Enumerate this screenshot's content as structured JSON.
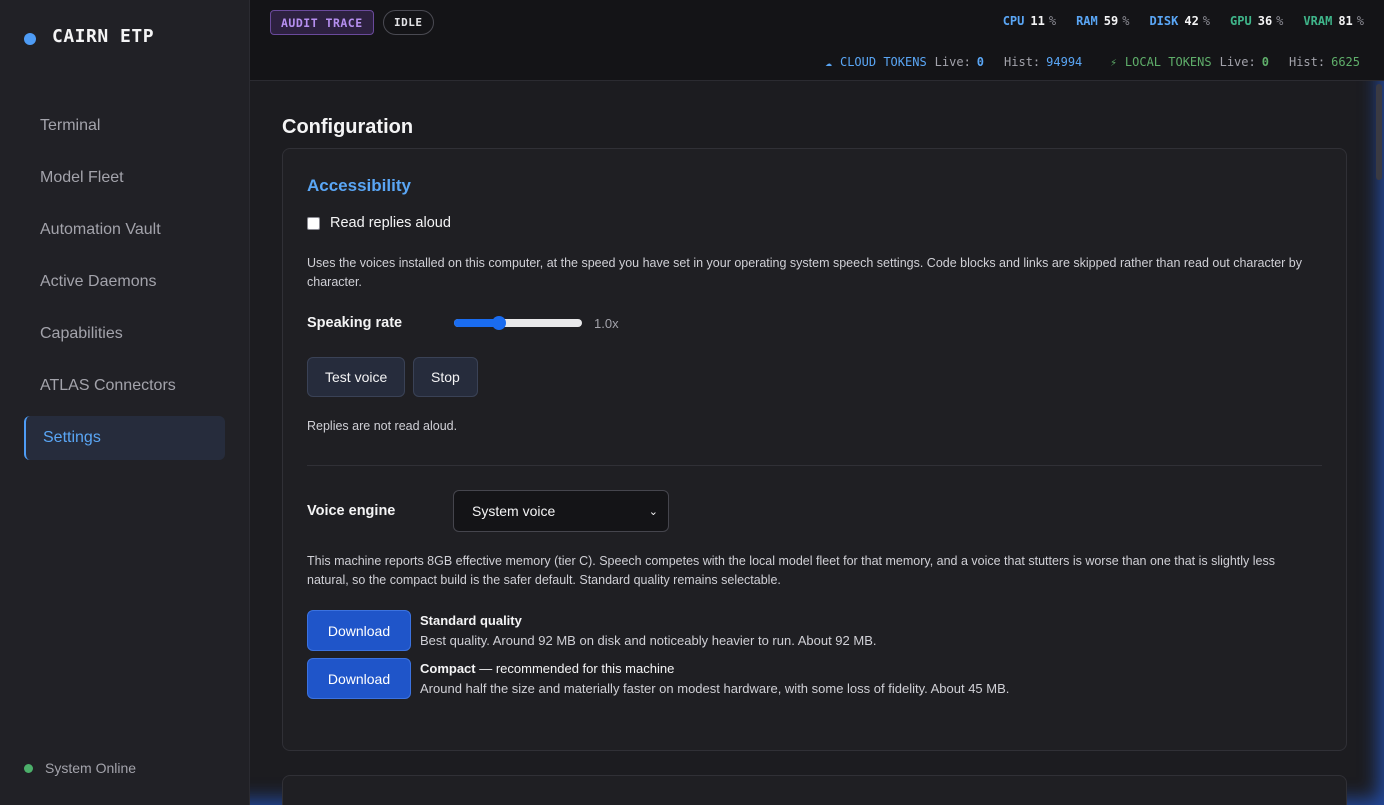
{
  "app": {
    "title": "CAIRN ETP"
  },
  "sidebar": {
    "items": [
      {
        "label": "Terminal",
        "active": false
      },
      {
        "label": "Model Fleet",
        "active": false
      },
      {
        "label": "Automation Vault",
        "active": false
      },
      {
        "label": "Active Daemons",
        "active": false
      },
      {
        "label": "Capabilities",
        "active": false
      },
      {
        "label": "ATLAS Connectors",
        "active": false
      },
      {
        "label": "Settings",
        "active": true
      }
    ],
    "status": "System Online"
  },
  "header": {
    "audit_chip": "AUDIT TRACE",
    "idle_chip": "IDLE",
    "metrics": [
      {
        "key": "CPU",
        "value": "11",
        "unit": "%",
        "color": "#5aa6f5"
      },
      {
        "key": "RAM",
        "value": "59",
        "unit": "%",
        "color": "#5aa6f5"
      },
      {
        "key": "DISK",
        "value": "42",
        "unit": "%",
        "color": "#5aa6f5"
      },
      {
        "key": "GPU",
        "value": "36",
        "unit": "%",
        "color": "#3fb58a"
      },
      {
        "key": "VRAM",
        "value": "81",
        "unit": "%",
        "color": "#3fb58a"
      }
    ],
    "cloud": {
      "icon": "cloud-icon",
      "label": "CLOUD TOKENS",
      "live_label": "Live:",
      "live": "0",
      "hist_label": "Hist:",
      "hist": "94994",
      "color": "#5aa6f5"
    },
    "local": {
      "icon": "bolt-icon",
      "label": "LOCAL TOKENS",
      "live_label": "Live:",
      "live": "0",
      "hist_label": "Hist:",
      "hist": "6625",
      "color": "#5fae6a"
    }
  },
  "main": {
    "title": "Configuration",
    "accessibility": {
      "title": "Accessibility",
      "read_aloud_label": "Read replies aloud",
      "read_aloud_checked": false,
      "description": "Uses the voices installed on this computer, at the speed you have set in your operating system speech settings. Code blocks and links are skipped rather than read out character by character.",
      "rate_label": "Speaking rate",
      "rate_value": "1.0x",
      "rate_fraction": 0.35,
      "test_button": "Test voice",
      "stop_button": "Stop",
      "status_note": "Replies are not read aloud.",
      "engine_label": "Voice engine",
      "engine_selected": "System voice",
      "memory_note": "This machine reports 8GB effective memory (tier C). Speech competes with the local model fleet for that memory, and a voice that stutters is worse than one that is slightly less natural, so the compact build is the safer default. Standard quality remains selectable.",
      "downloads": [
        {
          "button": "Download",
          "title": "Standard quality",
          "suffix": "",
          "desc": "Best quality. Around 92 MB on disk and noticeably heavier to run. About 92 MB."
        },
        {
          "button": "Download",
          "title": "Compact",
          "suffix": " — recommended for this machine",
          "desc": "Around half the size and materially faster on modest hardware, with some loss of fidelity. About 45 MB."
        }
      ]
    }
  }
}
